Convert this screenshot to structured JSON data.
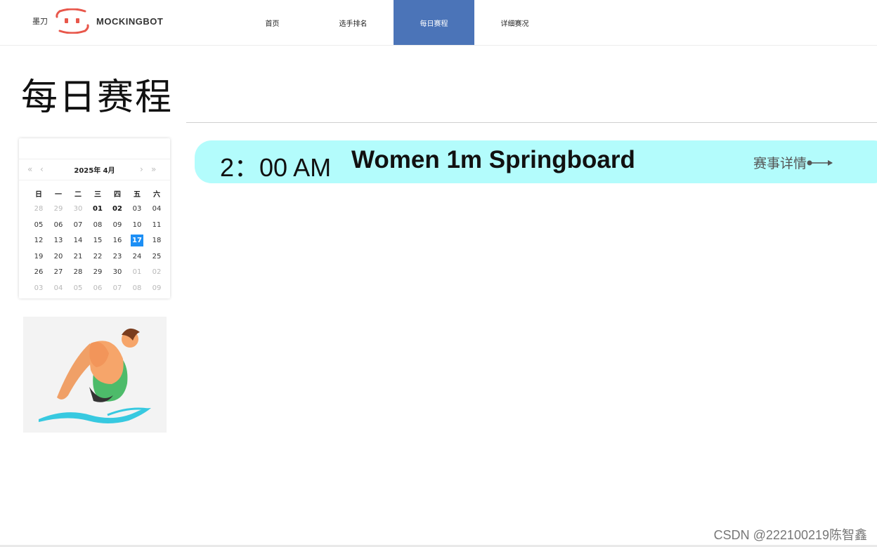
{
  "header": {
    "logo_cn": "墨刀",
    "logo_en": "MOCKINGBOT",
    "nav": [
      {
        "label": "首页"
      },
      {
        "label": "选手排名"
      },
      {
        "label": "每日赛程"
      },
      {
        "label": "详细赛况"
      }
    ],
    "active_index": 2,
    "accent_color": "#4b74b8"
  },
  "page": {
    "title": "每日赛程"
  },
  "calendar": {
    "month_label": "2025年 4月",
    "prev_year_icon": "double-chevron-left-icon",
    "prev_month_icon": "chevron-left-icon",
    "next_month_icon": "chevron-right-icon",
    "next_year_icon": "double-chevron-right-icon",
    "weekdays": [
      "日",
      "一",
      "二",
      "三",
      "四",
      "五",
      "六"
    ],
    "weeks": [
      [
        "28",
        "29",
        "30",
        "01",
        "02",
        "03",
        "04"
      ],
      [
        "05",
        "06",
        "07",
        "08",
        "09",
        "10",
        "11"
      ],
      [
        "12",
        "13",
        "14",
        "15",
        "16",
        "17",
        "18"
      ],
      [
        "19",
        "20",
        "21",
        "22",
        "23",
        "24",
        "25"
      ],
      [
        "26",
        "27",
        "28",
        "29",
        "30",
        "01",
        "02"
      ],
      [
        "03",
        "04",
        "05",
        "06",
        "07",
        "08",
        "09"
      ]
    ],
    "selected": "17",
    "selected_color": "#1d8ff5"
  },
  "event": {
    "time": "2：00 AM",
    "name": "Women 1m Springboard",
    "detail_label": "赛事详情",
    "card_color": "#b3fcfc"
  },
  "watermark": "CSDN @222100219陈智鑫"
}
